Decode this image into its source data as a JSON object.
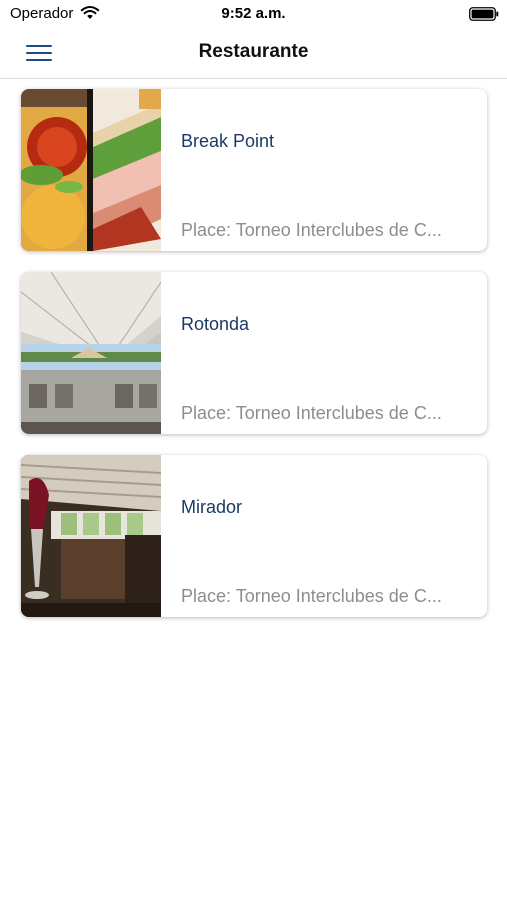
{
  "status_bar": {
    "carrier": "Operador",
    "time": "9:52 a.m.",
    "wifi_icon": "wifi-icon",
    "battery_icon": "battery-icon"
  },
  "nav": {
    "title": "Restaurante",
    "menu_icon": "hamburger-menu-icon",
    "accent_color": "#1f4a80"
  },
  "restaurants": [
    {
      "name": "Break Point",
      "place": "Place: Torneo Interclubes de C...",
      "image": "sandwich-and-salsa-photo"
    },
    {
      "name": "Rotonda",
      "place": "Place: Torneo Interclubes de C...",
      "image": "outdoor-tent-terrace-photo"
    },
    {
      "name": "Mirador",
      "place": "Place: Torneo Interclubes de C...",
      "image": "indoor-dining-room-photo"
    }
  ],
  "colors": {
    "title_text": "#1c3a66",
    "place_text": "#8d8d8d"
  }
}
